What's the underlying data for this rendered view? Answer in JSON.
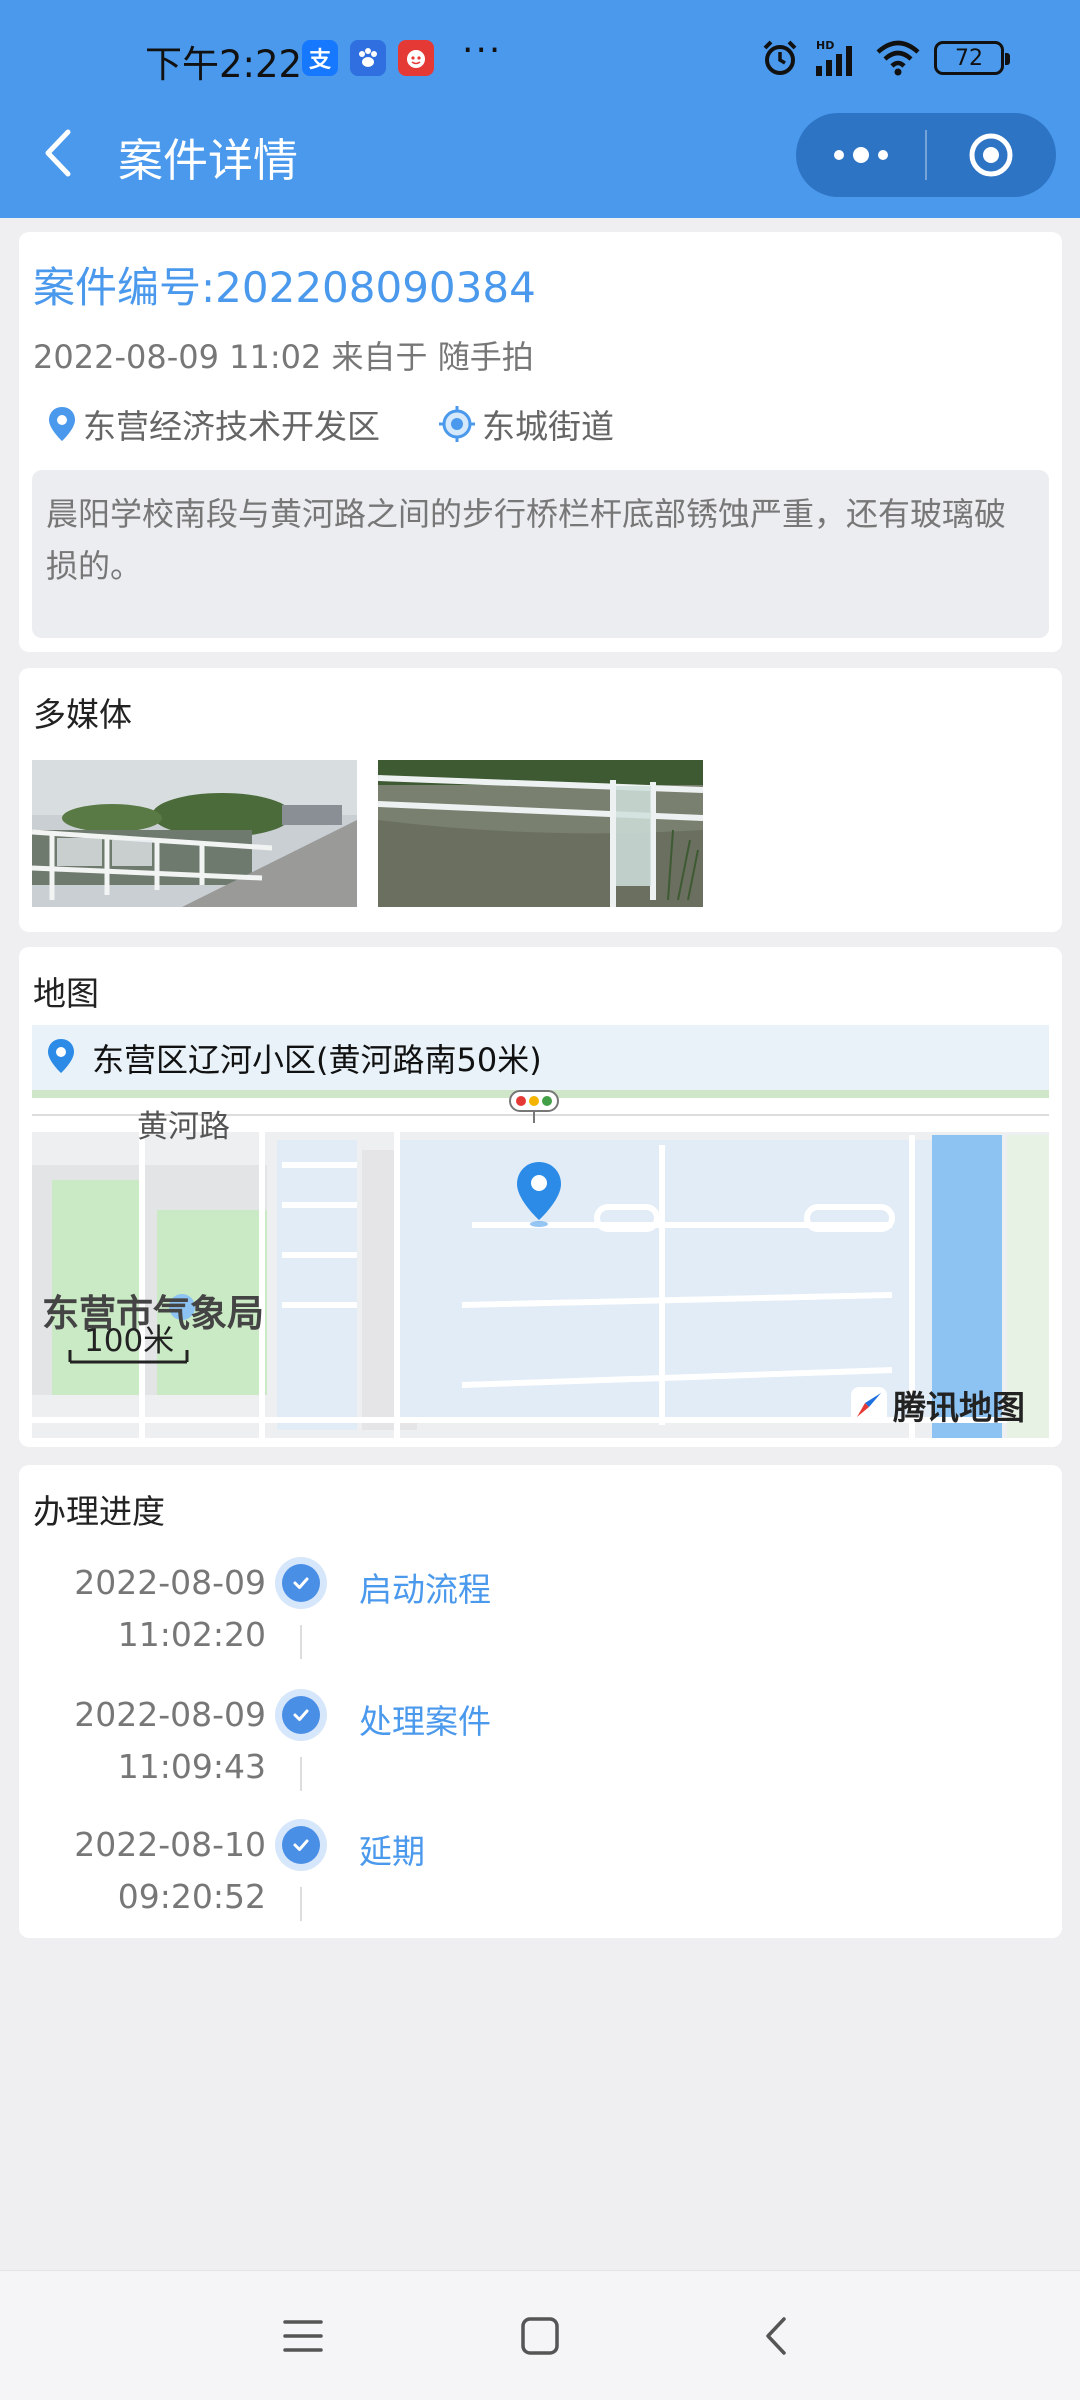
{
  "status_bar": {
    "time": "下午2:22",
    "more": "···",
    "battery": "72",
    "network_label": "HD"
  },
  "header": {
    "title": "案件详情"
  },
  "case": {
    "number_label": "案件编号:202208090384",
    "meta": "2022-08-09 11:02 来自于 随手拍",
    "district": "东营经济技术开发区",
    "street": "东城街道",
    "description": "晨阳学校南段与黄河路之间的步行桥栏杆底部锈蚀严重，还有玻璃破损的。"
  },
  "media": {
    "title": "多媒体"
  },
  "map": {
    "title": "地图",
    "location": "东营区辽河小区(黄河路南50米)",
    "road": "黄河路",
    "poi": "东营市气象局",
    "scale": "100米",
    "brand": "腾讯地图"
  },
  "progress": {
    "title": "办理进度",
    "steps": [
      {
        "date": "2022-08-09",
        "time": "11:02:20",
        "label": "启动流程"
      },
      {
        "date": "2022-08-09",
        "time": "11:09:43",
        "label": "处理案件"
      },
      {
        "date": "2022-08-10",
        "time": "09:20:52",
        "label": "延期"
      }
    ]
  },
  "colors": {
    "accent": "#4a99ec",
    "header_bg": "#4a99ec",
    "page_bg": "#efeff1"
  }
}
